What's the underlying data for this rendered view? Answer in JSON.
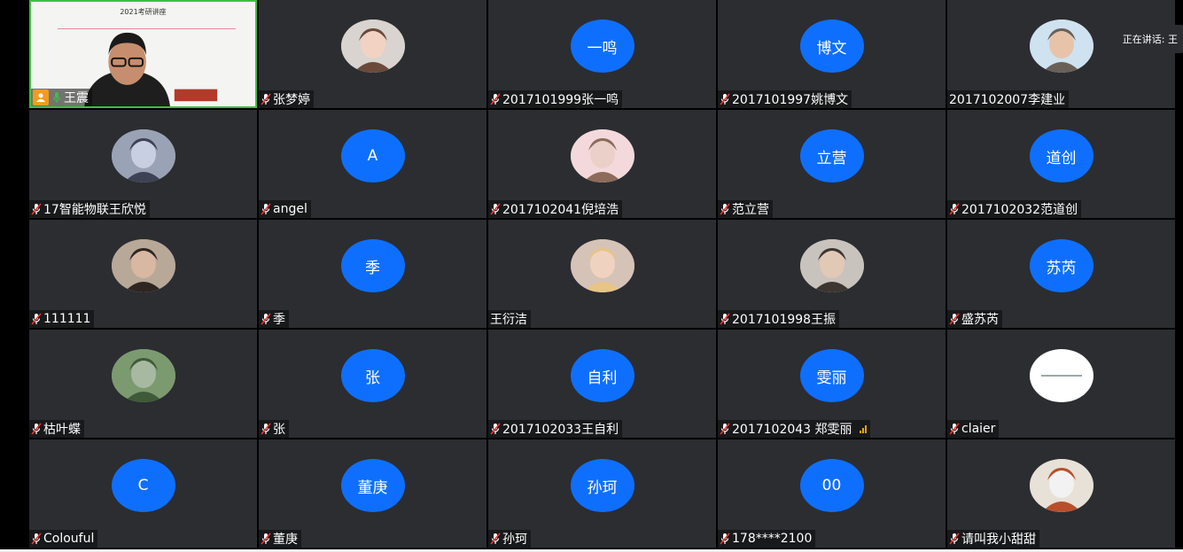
{
  "host_slide_title": "2021考研讲座",
  "speaking_label": "正在讲话: 王",
  "tiles": [
    {
      "name": "王震",
      "avatar": "host"
    },
    {
      "name": "张梦婷",
      "avatar": "photo"
    },
    {
      "name": "2017101999张一鸣",
      "avatar": "text",
      "avatar_text": "一鸣"
    },
    {
      "name": "2017101997姚博文",
      "avatar": "text",
      "avatar_text": "博文"
    },
    {
      "name": "2017102007李建业",
      "avatar": "photo",
      "muted_icon": false
    },
    {
      "name": "17智能物联王欣悦",
      "avatar": "photo"
    },
    {
      "name": "angel",
      "avatar": "text",
      "avatar_text": "A"
    },
    {
      "name": "2017102041倪培浩",
      "avatar": "photo"
    },
    {
      "name": "范立营",
      "avatar": "text",
      "avatar_text": "立营"
    },
    {
      "name": "2017102032范道创",
      "avatar": "text",
      "avatar_text": "道创"
    },
    {
      "name": "111111",
      "avatar": "photo"
    },
    {
      "name": "季",
      "avatar": "text",
      "avatar_text": "季"
    },
    {
      "name": "王衍洁",
      "avatar": "photo",
      "muted_icon": false
    },
    {
      "name": "2017101998王振",
      "avatar": "photo"
    },
    {
      "name": "盛苏芮",
      "avatar": "text",
      "avatar_text": "苏芮"
    },
    {
      "name": "枯叶蝶",
      "avatar": "photo"
    },
    {
      "name": "张",
      "avatar": "text",
      "avatar_text": "张"
    },
    {
      "name": "2017102033王自利",
      "avatar": "text",
      "avatar_text": "自利"
    },
    {
      "name": "2017102043 郑雯丽",
      "avatar": "text",
      "avatar_text": "雯丽",
      "signal": true
    },
    {
      "name": "claier",
      "avatar": "white"
    },
    {
      "name": "Colouful",
      "avatar": "text",
      "avatar_text": "C"
    },
    {
      "name": "董庚",
      "avatar": "text",
      "avatar_text": "董庚"
    },
    {
      "name": "孙珂",
      "avatar": "text",
      "avatar_text": "孙珂"
    },
    {
      "name": "178****2100",
      "avatar": "text",
      "avatar_text": "00"
    },
    {
      "name": "请叫我小甜甜",
      "avatar": "photo"
    }
  ],
  "colors": {
    "tile_bg": "#2b2d31",
    "avatar_blue": "#0e6fff",
    "host_border": "#3fbf3f",
    "host_badge": "#f39a1e"
  }
}
